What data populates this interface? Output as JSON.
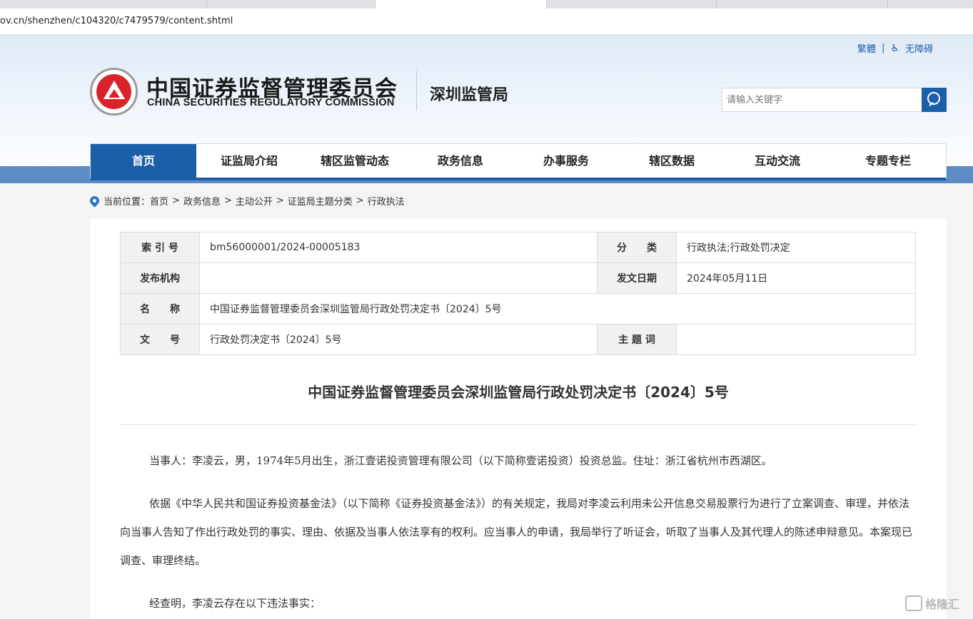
{
  "browser": {
    "url": "ov.cn/shenzhen/c104320/c7479579/content.shtml"
  },
  "header": {
    "traditional_link": "繁體",
    "separator": "|",
    "accessibility_link": "无障碍",
    "org_name_cn": "中国证券监督管理委员会",
    "org_name_en": "CHINA SECURITIES REGULATORY COMMISSION",
    "bureau": "深圳监管局",
    "search_placeholder": "请输入关键字"
  },
  "nav": {
    "items": [
      "首页",
      "证监局介绍",
      "辖区监管动态",
      "政务信息",
      "办事服务",
      "辖区数据",
      "互动交流",
      "专题专栏"
    ],
    "active_index": 0
  },
  "breadcrumb": {
    "label": "当前位置：",
    "items": [
      "首页",
      "政务信息",
      "主动公开",
      "证监局主题分类",
      "行政执法"
    ],
    "separator": ">"
  },
  "meta": {
    "index_label": "索 引 号",
    "index_value": "bm56000001/2024-00005183",
    "category_label": "分　　类",
    "category_value": "行政执法;行政处罚决定",
    "publisher_label": "发布机构",
    "publisher_value": "",
    "date_label": "发文日期",
    "date_value": "2024年05月11日",
    "name_label": "名　　称",
    "name_value": "中国证券监督管理委员会深圳监管局行政处罚决定书〔2024〕5号",
    "docno_label": "文　　号",
    "docno_value": "行政处罚决定书〔2024〕5号",
    "keywords_label": "主 题 词",
    "keywords_value": ""
  },
  "document": {
    "title": "中国证券监督管理委员会深圳监管局行政处罚决定书〔2024〕5号",
    "paragraphs": [
      "当事人：李凌云，男，1974年5月出生，浙江壹诺投资管理有限公司（以下简称壹诺投资）投资总监。住址：浙江省杭州市西湖区。",
      "依据《中华人民共和国证券投资基金法》（以下简称《证券投资基金法》）的有关规定，我局对李凌云利用未公开信息交易股票行为进行了立案调查、审理，并依法向当事人告知了作出行政处罚的事实、理由、依据及当事人依法享有的权利。应当事人的申请，我局举行了听证会，听取了当事人及其代理人的陈述申辩意见。本案现已调查、审理终结。",
      "经查明，李凌云存在以下违法事实："
    ]
  },
  "watermark": {
    "text": "格隆汇"
  }
}
